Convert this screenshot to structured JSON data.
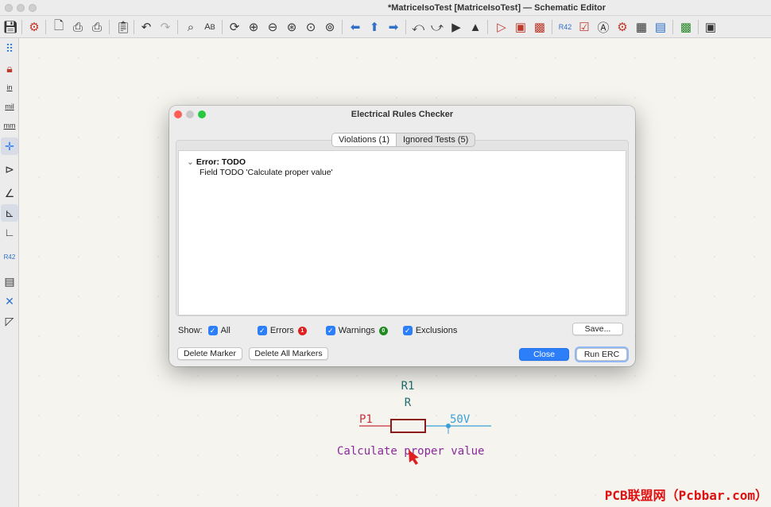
{
  "window": {
    "title": "*MatriceIsoTest [MatriceIsoTest] — Schematic Editor"
  },
  "toolbar": {
    "icons": [
      "save-icon",
      "schematic-setup-icon",
      "page-settings-icon",
      "print-icon",
      "plot-icon",
      "paste-icon",
      "undo-icon",
      "redo-icon",
      "find-icon",
      "find-replace-icon",
      "refresh-icon",
      "zoom-in-icon",
      "zoom-out-icon",
      "zoom-fit-icon",
      "zoom-objects-icon",
      "zoom-selection-icon",
      "navigate-back-icon",
      "navigate-up-icon",
      "navigate-forward-icon",
      "rotate-ccw-icon",
      "rotate-cw-icon",
      "mirror-v-icon",
      "mirror-h-icon",
      "symbol-editor-icon",
      "symbol-browser-icon",
      "update-pcb-icon",
      "annotate-icon",
      "erc-icon",
      "simulator-icon",
      "assign-footprints-icon",
      "bom-icon",
      "edit-fields-icon",
      "bom-generate-icon",
      "pcb-editor-icon",
      "scripting-console-icon"
    ]
  },
  "left_toolbar": {
    "units": [
      "in",
      "mil",
      "mm"
    ],
    "icons": [
      "grid-icon",
      "lock-icon",
      "inches-icon",
      "mils-icon",
      "millimeters-icon",
      "cursor-icon",
      "hidden-pins-icon",
      "wire-45-icon",
      "wire-90-icon",
      "wire-free-icon",
      "annotate-ref-icon",
      "hierarchy-navigator-icon",
      "properties-icon",
      "draw-rectangle-icon"
    ]
  },
  "dialog": {
    "title": "Electrical Rules Checker",
    "tabs": {
      "violations": "Violations (1)",
      "ignored": "Ignored Tests (5)"
    },
    "violation": {
      "title": "Error: TODO",
      "detail": "Field TODO 'Calculate proper value'"
    },
    "filters": {
      "show_label": "Show:",
      "all": "All",
      "errors": "Errors",
      "errors_count": "1",
      "warnings": "Warnings",
      "warnings_count": "0",
      "exclusions": "Exclusions"
    },
    "buttons": {
      "save": "Save...",
      "delete_marker": "Delete Marker",
      "delete_all_markers": "Delete All Markers",
      "close": "Close",
      "run_erc": "Run ERC"
    }
  },
  "schematic": {
    "reference": "R1",
    "value": "R",
    "net_left": "P1",
    "net_right": "50V",
    "field_text": "Calculate proper value"
  },
  "watermark": "PCB联盟网（Pcbbar.com）",
  "colors": {
    "accent": "#2d7ff9",
    "error_badge": "#e02020",
    "warning_badge": "#1f8a1f",
    "component_body": "#8b1a1a",
    "label_red": "#c8303a",
    "label_blue": "#3a9fd8",
    "reference_teal": "#1f6e6e",
    "field_purple": "#8a2a9a"
  }
}
